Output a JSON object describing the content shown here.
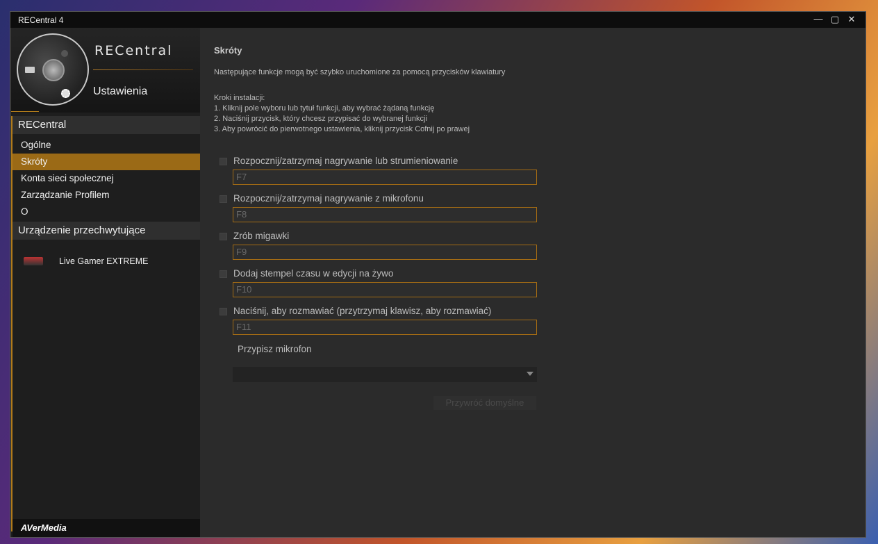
{
  "window": {
    "title": "RECentral 4",
    "controls": [
      "minimize-icon",
      "maximize-icon",
      "close-icon"
    ]
  },
  "sidebar": {
    "brand": "RECentral",
    "header_title": "Ustawienia",
    "section_recentral": "RECentral",
    "items": [
      {
        "label": "Ogólne"
      },
      {
        "label": "Skróty",
        "active": true
      },
      {
        "label": "Konta sieci społecznej"
      },
      {
        "label": "Zarządzanie Profilem"
      },
      {
        "label": "O"
      }
    ],
    "section_devices": "Urządzenie przechwytujące",
    "device": {
      "label": "Live Gamer EXTREME"
    },
    "footer": "AVerMedia"
  },
  "main": {
    "title": "Skróty",
    "intro": "Następujące funkcje mogą być szybko uruchomione za pomocą przycisków klawiatury",
    "steps_title": "Kroki instalacji:",
    "steps": [
      "1. Kliknij pole wyboru lub tytuł funkcji, aby wybrać żądaną funkcję",
      "2. Naciśnij przycisk, który chcesz przypisać do wybranej funkcji",
      "3. Aby powrócić do pierwotnego ustawienia, kliknij przycisk Cofnij po prawej"
    ],
    "shortcuts": [
      {
        "label": "Rozpocznij/zatrzymaj nagrywanie lub strumieniowanie",
        "key": "F7",
        "checked": false
      },
      {
        "label": "Rozpocznij/zatrzymaj nagrywanie z mikrofonu",
        "key": "F8",
        "checked": false
      },
      {
        "label": "Zrób migawki",
        "key": "F9",
        "checked": false
      },
      {
        "label": "Dodaj stempel czasu w edycji na żywo",
        "key": "F10",
        "checked": false
      },
      {
        "label": "Naciśnij, aby rozmawiać (przytrzymaj klawisz, aby rozmawiać)",
        "key": "F11",
        "checked": false
      }
    ],
    "assign_mic_label": "Przypisz mikrofon",
    "assign_mic_value": "",
    "reset_button": "Przywróć domyślne"
  },
  "colors": {
    "accent": "#9b6a16",
    "field_border": "#a46c14",
    "background": "#2b2b2b"
  }
}
